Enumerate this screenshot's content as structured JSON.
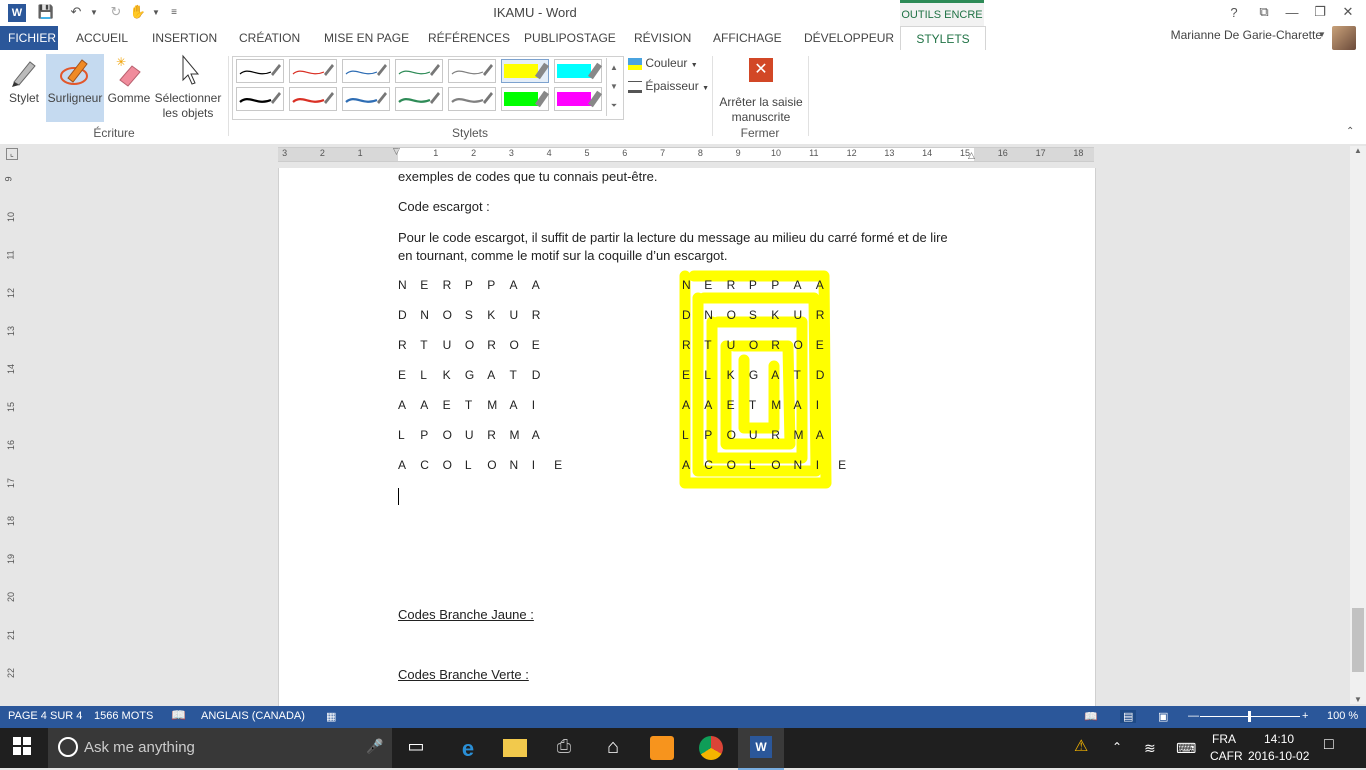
{
  "window": {
    "title": "IKAMU - Word",
    "context_tab": "OUTILS ENCRE",
    "buttons": [
      "?",
      "⧉",
      "—",
      "❐",
      "✕"
    ]
  },
  "tabs": [
    {
      "label": "FICHIER"
    },
    {
      "label": "ACCUEIL"
    },
    {
      "label": "INSERTION"
    },
    {
      "label": "CRÉATION"
    },
    {
      "label": "MISE EN PAGE"
    },
    {
      "label": "RÉFÉRENCES"
    },
    {
      "label": "PUBLIPOSTAGE"
    },
    {
      "label": "RÉVISION"
    },
    {
      "label": "AFFICHAGE"
    },
    {
      "label": "DÉVELOPPEUR"
    },
    {
      "label": "STYLETS"
    }
  ],
  "user": "Marianne De Garie-Charette",
  "ribbon": {
    "ecriture": {
      "label": "Écriture",
      "stylet": "Stylet",
      "surligneur": "Surligneur",
      "gomme": "Gomme",
      "selectionner1": "Sélectionner",
      "selectionner2": "les objets"
    },
    "stylets": {
      "label": "Stylets",
      "couleur": "Couleur",
      "epaisseur": "Épaisseur",
      "pens_row1": [
        "#000000",
        "#d93025",
        "#2e6db4",
        "#2e8b57",
        "#808080",
        "#ffff00",
        "#00ffff"
      ],
      "pens_row2": [
        "#000000",
        "#d93025",
        "#2e6db4",
        "#2e8b57",
        "#808080",
        "#00ff00",
        "#ff00ff"
      ]
    },
    "fermer": {
      "label": "Fermer",
      "stop1": "Arrêter la saisie",
      "stop2": "manuscrite"
    }
  },
  "ruler": {
    "h_ticks": [
      "3",
      "2",
      "1",
      "1",
      "2",
      "3",
      "4",
      "5",
      "6",
      "7",
      "8",
      "9",
      "10",
      "11",
      "12",
      "13",
      "14",
      "15",
      "16",
      "17",
      "18"
    ],
    "v_ticks": [
      "9",
      "10",
      "11",
      "12",
      "13",
      "14",
      "15",
      "16",
      "17",
      "18",
      "19",
      "20",
      "21",
      "22"
    ]
  },
  "document": {
    "line1": "exemples de codes que tu connais peut-être.",
    "heading": "Code escargot :",
    "para1": "Pour le code escargot, il suffit de partir la lecture du message au milieu du carré formé et de lire",
    "para2": "en tournant, comme le motif sur la coquille d’un escargot.",
    "grid": [
      [
        "N",
        "E",
        "R",
        "P",
        "P",
        "A",
        "A"
      ],
      [
        "D",
        "N",
        "O",
        "S",
        "K",
        "U",
        "R"
      ],
      [
        "R",
        "T",
        "U",
        "O",
        "R",
        "O",
        "E"
      ],
      [
        "E",
        "L",
        "K",
        "G",
        "A",
        "T",
        "D"
      ],
      [
        "A",
        "A",
        "E",
        "T",
        "M",
        "A",
        "I"
      ],
      [
        "L",
        "P",
        "O",
        "U",
        "R",
        "M",
        "A"
      ],
      [
        "A",
        "C",
        "O",
        "L",
        "O",
        "N",
        "I",
        "E"
      ]
    ],
    "jaune": "Codes Branche Jaune :",
    "verte": "Codes Branche Verte :",
    "highlight_color": "#ffff00"
  },
  "status": {
    "page": "PAGE 4 SUR 4",
    "words": "1566 MOTS",
    "lang": "ANGLAIS (CANADA)",
    "zoom": "100 %"
  },
  "taskbar": {
    "search_placeholder": "Ask me anything",
    "lang1": "FRA",
    "lang2": "CAFR",
    "time": "14:10",
    "date": "2016-10-02"
  },
  "colors": {
    "word_blue": "#2b579a",
    "ink_green": "#217346"
  }
}
